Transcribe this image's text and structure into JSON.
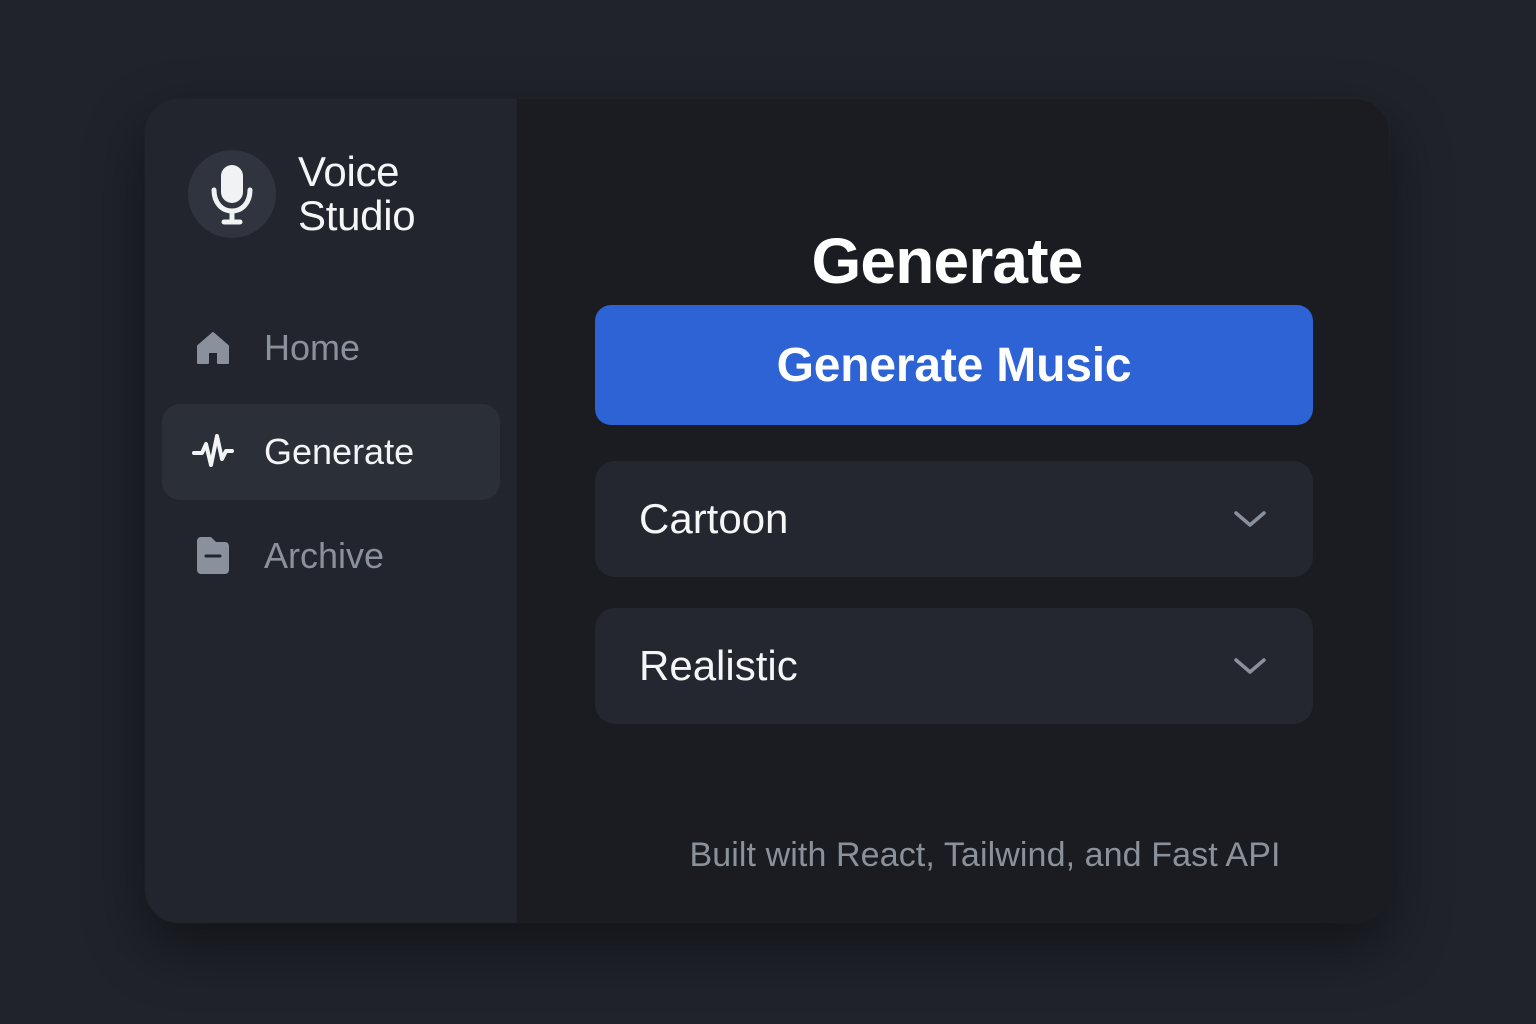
{
  "brand": {
    "line1": "Voice",
    "line2": "Studio",
    "icon": "microphone-icon"
  },
  "sidebar": {
    "items": [
      {
        "label": "Home",
        "icon": "home-icon",
        "active": false
      },
      {
        "label": "Generate",
        "icon": "waveform-icon",
        "active": true
      },
      {
        "label": "Archive",
        "icon": "folder-icon",
        "active": false
      }
    ]
  },
  "main": {
    "title": "Generate",
    "generate_button": "Generate Music",
    "selects": [
      {
        "value": "Cartoon",
        "icon": "chevron-down-icon"
      },
      {
        "value": "Realistic",
        "icon": "chevron-down-icon"
      }
    ],
    "footer": "Built with React, Tailwind, and Fast API"
  },
  "colors": {
    "page_background": "#20232b",
    "sidebar_background": "#22252d",
    "main_background": "#1a1c21",
    "accent": "#2d63d4",
    "active_nav": "#2b2f38",
    "select_background": "#242730",
    "muted_text": "#8b919c"
  }
}
